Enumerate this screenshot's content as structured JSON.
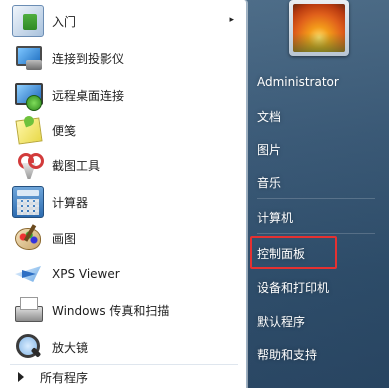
{
  "programs": [
    {
      "label": "入门",
      "has_submenu": true,
      "icon": "getting-started-icon"
    },
    {
      "label": "连接到投影仪",
      "has_submenu": false,
      "icon": "projector-icon"
    },
    {
      "label": "远程桌面连接",
      "has_submenu": false,
      "icon": "remote-desktop-icon"
    },
    {
      "label": "便笺",
      "has_submenu": false,
      "icon": "sticky-notes-icon"
    },
    {
      "label": "截图工具",
      "has_submenu": false,
      "icon": "snipping-tool-icon"
    },
    {
      "label": "计算器",
      "has_submenu": false,
      "icon": "calculator-icon"
    },
    {
      "label": "画图",
      "has_submenu": false,
      "icon": "paint-icon"
    },
    {
      "label": "XPS Viewer",
      "has_submenu": false,
      "icon": "xps-viewer-icon"
    },
    {
      "label": "Windows 传真和扫描",
      "has_submenu": false,
      "icon": "fax-scan-icon"
    },
    {
      "label": "放大镜",
      "has_submenu": false,
      "icon": "magnifier-icon"
    }
  ],
  "submenu_arrow": "▸",
  "all_programs_label": "所有程序",
  "right": {
    "username": "Administrator",
    "items": [
      {
        "label": "文档"
      },
      {
        "label": "图片"
      },
      {
        "label": "音乐"
      },
      {
        "label": "计算机"
      },
      {
        "label": "控制面板",
        "highlighted": true
      },
      {
        "label": "设备和打印机"
      },
      {
        "label": "默认程序"
      },
      {
        "label": "帮助和支持"
      }
    ]
  },
  "colors": {
    "highlight_border": "#e53131",
    "right_panel": "#3a5a78"
  }
}
